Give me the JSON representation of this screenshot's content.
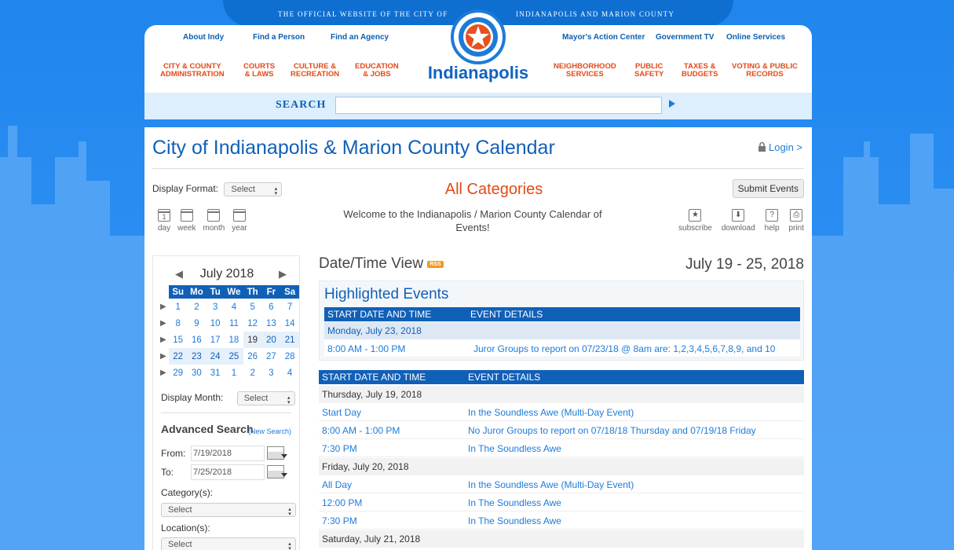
{
  "header": {
    "tagline_left": "THE OFFICIAL WEBSITE OF THE CITY OF",
    "tagline_right": "INDIANAPOLIS AND MARION COUNTY",
    "top_links": [
      "About Indy",
      "Find a Person",
      "Find an Agency",
      "Mayor's Action Center",
      "Government TV",
      "Online Services"
    ],
    "nav": [
      {
        "l1": "CITY & COUNTY",
        "l2": "ADMINISTRATION"
      },
      {
        "l1": "COURTS",
        "l2": "& LAWS"
      },
      {
        "l1": "CULTURE &",
        "l2": "RECREATION"
      },
      {
        "l1": "EDUCATION",
        "l2": "& JOBS"
      },
      {
        "l1": "NEIGHBORHOOD",
        "l2": "SERVICES"
      },
      {
        "l1": "PUBLIC",
        "l2": "SAFETY"
      },
      {
        "l1": "TAXES &",
        "l2": "BUDGETS"
      },
      {
        "l1": "VOTING & PUBLIC",
        "l2": "RECORDS"
      }
    ],
    "logo_text": "Indianapolis",
    "search_label": "SEARCH",
    "search_value": ""
  },
  "page": {
    "title": "City of Indianapolis & Marion County Calendar",
    "login": "Login >",
    "display_format_label": "Display Format:",
    "display_format_value": "Select",
    "views": [
      "day",
      "week",
      "month",
      "year"
    ],
    "day_icon_number": "1",
    "category_heading": "All Categories",
    "welcome": "Welcome to the Indianapolis / Marion County Calendar of Events!",
    "submit_events": "Submit Events",
    "tools": [
      "subscribe",
      "download",
      "help",
      "print"
    ]
  },
  "mini_calendar": {
    "month": "July 2018",
    "weekdays": [
      "Su",
      "Mo",
      "Tu",
      "We",
      "Th",
      "Fr",
      "Sa"
    ],
    "weeks": [
      [
        "1",
        "2",
        "3",
        "4",
        "5",
        "6",
        "7"
      ],
      [
        "8",
        "9",
        "10",
        "11",
        "12",
        "13",
        "14"
      ],
      [
        "15",
        "16",
        "17",
        "18",
        "19",
        "20",
        "21"
      ],
      [
        "22",
        "23",
        "24",
        "25",
        "26",
        "27",
        "28"
      ],
      [
        "29",
        "30",
        "31",
        "1",
        "2",
        "3",
        "4"
      ]
    ],
    "display_month_label": "Display Month:",
    "display_month_value": "Select"
  },
  "advanced_search": {
    "title": "Advanced Search",
    "new_search": "(New Search)",
    "from_label": "From:",
    "from_value": "7/19/2018",
    "to_label": "To:",
    "to_value": "7/25/2018",
    "category_label": "Category(s):",
    "category_value": "Select",
    "location_label": "Location(s):",
    "location_value": "Select"
  },
  "events": {
    "view_title": "Date/Time View",
    "rss": "RSS",
    "range": "July 19 - 25, 2018",
    "highlighted_title": "Highlighted Events",
    "col_start": "START DATE AND TIME",
    "col_details": "EVENT DETAILS",
    "highlighted": {
      "date": "Monday, July 23, 2018",
      "time": "8:00 AM - 1:00 PM",
      "detail": "Juror Groups to report on 07/23/18 @ 8am are: 1,2,3,4,5,6,7,8,9, and 10"
    },
    "days": [
      {
        "date": "Thursday, July 19, 2018",
        "items": [
          {
            "time": "Start Day",
            "detail": "In the Soundless Awe (Multi-Day Event)"
          },
          {
            "time": "8:00 AM - 1:00 PM",
            "detail": "No Juror Groups to report on 07/18/18 Thursday and 07/19/18 Friday"
          },
          {
            "time": "7:30 PM",
            "detail": "In The Soundless Awe"
          }
        ]
      },
      {
        "date": "Friday, July 20, 2018",
        "items": [
          {
            "time": "All Day",
            "detail": "In the Soundless Awe (Multi-Day Event)"
          },
          {
            "time": "12:00 PM",
            "detail": "In The Soundless Awe"
          },
          {
            "time": "7:30 PM",
            "detail": "In The Soundless Awe"
          }
        ]
      },
      {
        "date": "Saturday, July 21, 2018",
        "items": []
      }
    ]
  },
  "colors": {
    "brand_blue": "#1160b8",
    "accent_orange": "#e24a17",
    "background": "#2f8df2"
  }
}
